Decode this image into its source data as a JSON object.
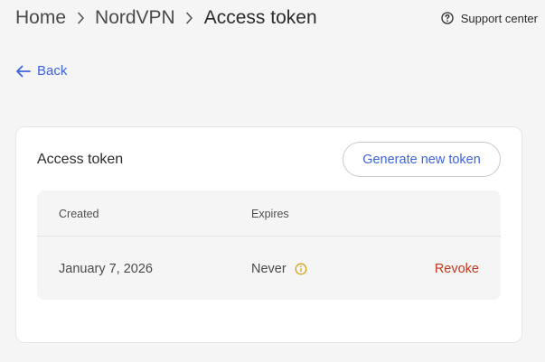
{
  "breadcrumb": {
    "items": [
      {
        "label": "Home"
      },
      {
        "label": "NordVPN"
      },
      {
        "label": "Access token"
      }
    ]
  },
  "support": {
    "label": "Support center",
    "icon": "help-circle-icon"
  },
  "back": {
    "label": "Back",
    "icon": "arrow-left-icon"
  },
  "card": {
    "title": "Access token",
    "generate_label": "Generate new token",
    "table": {
      "columns": [
        "Created",
        "Expires"
      ],
      "rows": [
        {
          "created": "January 7, 2026",
          "expires": "Never",
          "action": "Revoke"
        }
      ]
    }
  },
  "colors": {
    "accent": "#3d63dd",
    "danger": "#c4361c",
    "warning": "#d9a21b",
    "background": "#f5f5f5"
  }
}
